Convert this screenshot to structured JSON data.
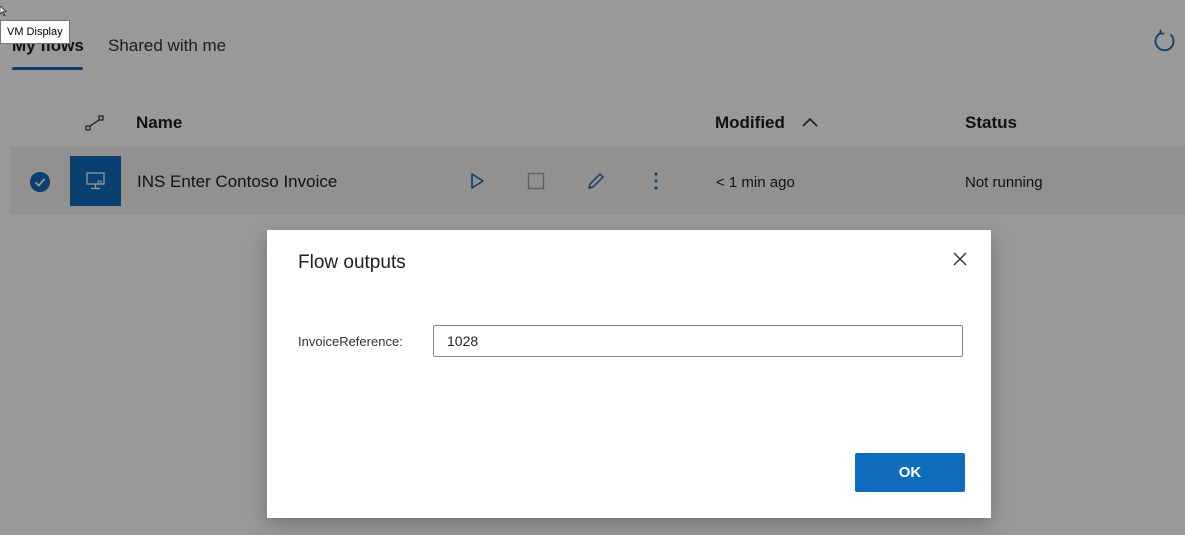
{
  "tooltip": {
    "text": "VM Display"
  },
  "tabs": [
    {
      "label": "My flows",
      "active": true
    },
    {
      "label": "Shared with me",
      "active": false
    }
  ],
  "header": {
    "refresh_icon": "refresh-icon",
    "columns": {
      "type_icon": "flow-type-icon",
      "name": "Name",
      "modified": "Modified",
      "modified_sort_icon": "chevron-up-icon",
      "status": "Status"
    }
  },
  "flows": [
    {
      "selected": true,
      "icon": "desktop-flow-icon",
      "name": "INS Enter Contoso Invoice",
      "actions": [
        "play-icon",
        "stop-icon",
        "edit-icon",
        "more-icon"
      ],
      "modified": "< 1 min ago",
      "status": "Not running"
    }
  ],
  "dialog": {
    "title": "Flow outputs",
    "close_icon": "close-icon",
    "fields": [
      {
        "label": "InvoiceReference:",
        "value": "1028"
      }
    ],
    "ok_label": "OK"
  },
  "colors": {
    "accent": "#0f6cbd",
    "row_selected": "#f3f2f1",
    "overlay": "rgba(0,0,0,0.4)"
  }
}
